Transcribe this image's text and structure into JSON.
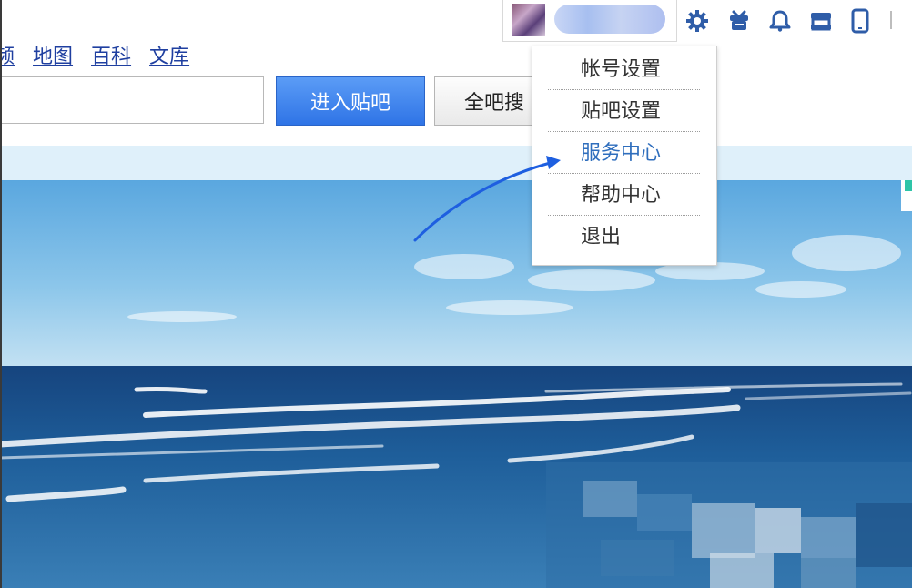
{
  "nav": {
    "items": [
      "频",
      "地图",
      "百科",
      "文库"
    ]
  },
  "search": {
    "value": "",
    "placeholder": ""
  },
  "buttons": {
    "enter": "进入贴吧",
    "all_search": "全吧搜"
  },
  "user": {
    "name": ""
  },
  "icons": [
    "gear-icon",
    "gift-icon",
    "bell-icon",
    "store-icon",
    "tablet-icon"
  ],
  "menu": {
    "items": [
      "帐号设置",
      "贴吧设置",
      "服务中心",
      "帮助中心",
      "退出"
    ],
    "active_index": 2
  },
  "colors": {
    "link": "#1f3fa0",
    "accent": "#2f74e6",
    "active_menu": "#2f6ebd",
    "icon": "#2f5da8",
    "annotation_arrow": "#1e5fe0"
  }
}
